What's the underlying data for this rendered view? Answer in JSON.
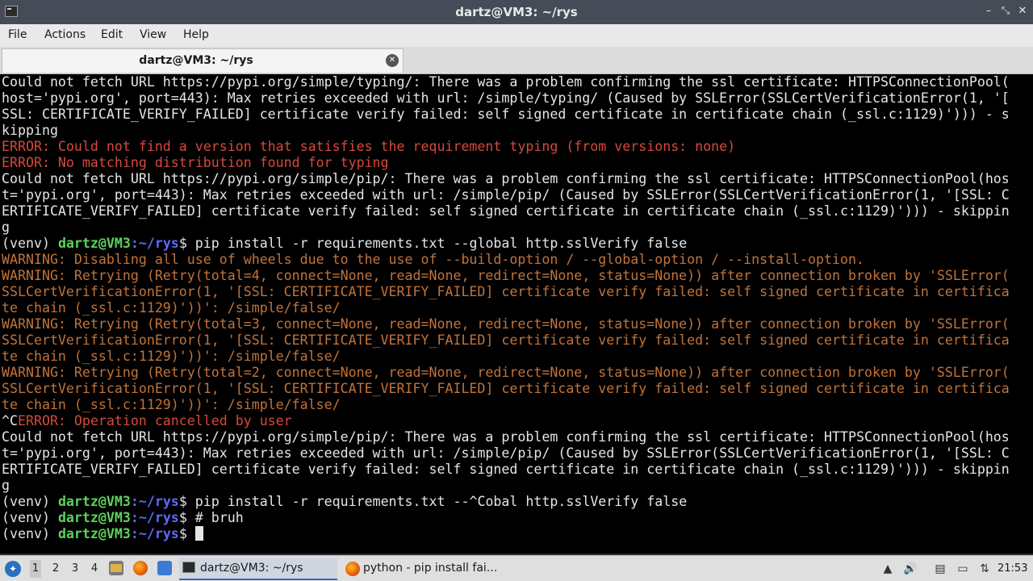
{
  "window": {
    "title": "dartz@VM3: ~/rys",
    "controls": {
      "minimize": "–",
      "maximize": "⤡",
      "close": "✕"
    }
  },
  "menu": [
    "File",
    "Actions",
    "Edit",
    "View",
    "Help"
  ],
  "tab": {
    "label": "dartz@VM3: ~/rys",
    "close": "✕"
  },
  "colors": {
    "error": "#d44a3b",
    "warning": "#c1733a",
    "user": "#5bd35b",
    "path": "#5a6bff",
    "text": "#e5e5e5",
    "background": "#000000"
  },
  "terminal": {
    "lines": [
      {
        "text": "Could not fetch URL https://pypi.org/simple/typing/: There was a problem confirming the ssl certificate: HTTPSConnectionPool("
      },
      {
        "text": "host='pypi.org', port=443): Max retries exceeded with url: /simple/typing/ (Caused by SSLError(SSLCertVerificationError(1, '["
      },
      {
        "text": "SSL: CERTIFICATE_VERIFY_FAILED] certificate verify failed: self signed certificate in certificate chain (_ssl.c:1129)'))) - s"
      },
      {
        "text": "kipping"
      },
      {
        "text": "ERROR: Could not find a version that satisfies the requirement typing (from versions: none)",
        "kind": "err"
      },
      {
        "text": "ERROR: No matching distribution found for typing",
        "kind": "err"
      },
      {
        "text": "Could not fetch URL https://pypi.org/simple/pip/: There was a problem confirming the ssl certificate: HTTPSConnectionPool(hos"
      },
      {
        "text": "t='pypi.org', port=443): Max retries exceeded with url: /simple/pip/ (Caused by SSLError(SSLCertVerificationError(1, '[SSL: C"
      },
      {
        "text": "ERTIFICATE_VERIFY_FAILED] certificate verify failed: self signed certificate in certificate chain (_ssl.c:1129)'))) - skippin"
      },
      {
        "text": "g"
      },
      {
        "prompt": true,
        "venv": "(venv) ",
        "user": "dartz@VM3",
        "path": ":~/rys",
        "cmd": "$ pip install -r requirements.txt --global http.sslVerify false"
      },
      {
        "text": "WARNING: Disabling all use of wheels due to the use of --build-option / --global-option / --install-option.",
        "kind": "warn"
      },
      {
        "text": "WARNING: Retrying (Retry(total=4, connect=None, read=None, redirect=None, status=None)) after connection broken by 'SSLError(",
        "kind": "warn"
      },
      {
        "text": "SSLCertVerificationError(1, '[SSL: CERTIFICATE_VERIFY_FAILED] certificate verify failed: self signed certificate in certifica",
        "kind": "warn"
      },
      {
        "text": "te chain (_ssl.c:1129)'))': /simple/false/",
        "kind": "warn"
      },
      {
        "text": "WARNING: Retrying (Retry(total=3, connect=None, read=None, redirect=None, status=None)) after connection broken by 'SSLError(",
        "kind": "warn"
      },
      {
        "text": "SSLCertVerificationError(1, '[SSL: CERTIFICATE_VERIFY_FAILED] certificate verify failed: self signed certificate in certifica",
        "kind": "warn"
      },
      {
        "text": "te chain (_ssl.c:1129)'))': /simple/false/",
        "kind": "warn"
      },
      {
        "text": "WARNING: Retrying (Retry(total=2, connect=None, read=None, redirect=None, status=None)) after connection broken by 'SSLError(",
        "kind": "warn"
      },
      {
        "text": "SSLCertVerificationError(1, '[SSL: CERTIFICATE_VERIFY_FAILED] certificate verify failed: self signed certificate in certifica",
        "kind": "warn"
      },
      {
        "text": "te chain (_ssl.c:1129)'))': /simple/false/",
        "kind": "warn"
      },
      {
        "mixed": true,
        "plain": "^C",
        "rest": "ERROR: Operation cancelled by user"
      },
      {
        "text": "Could not fetch URL https://pypi.org/simple/pip/: There was a problem confirming the ssl certificate: HTTPSConnectionPool(hos"
      },
      {
        "text": "t='pypi.org', port=443): Max retries exceeded with url: /simple/pip/ (Caused by SSLError(SSLCertVerificationError(1, '[SSL: C"
      },
      {
        "text": "ERTIFICATE_VERIFY_FAILED] certificate verify failed: self signed certificate in certificate chain (_ssl.c:1129)'))) - skippin"
      },
      {
        "text": "g"
      },
      {
        "prompt": true,
        "venv": "(venv) ",
        "user": "dartz@VM3",
        "path": ":~/rys",
        "cmd": "$ pip install -r requirements.txt --^Cobal http.sslVerify false"
      },
      {
        "prompt": true,
        "venv": "(venv) ",
        "user": "dartz@VM3",
        "path": ":~/rys",
        "cmd": "$ # bruh"
      },
      {
        "prompt": true,
        "venv": "(venv) ",
        "user": "dartz@VM3",
        "path": ":~/rys",
        "cmd": "$ ",
        "cursor": true
      }
    ]
  },
  "taskbar": {
    "workspaces": [
      "1",
      "2",
      "3",
      "4"
    ],
    "active_workspace": "1",
    "tasks": [
      {
        "label": "dartz@VM3: ~/rys",
        "icon": "terminal-icon"
      },
      {
        "label": "python - pip install fai...",
        "icon": "firefox-icon"
      }
    ],
    "clock": "21:53"
  }
}
